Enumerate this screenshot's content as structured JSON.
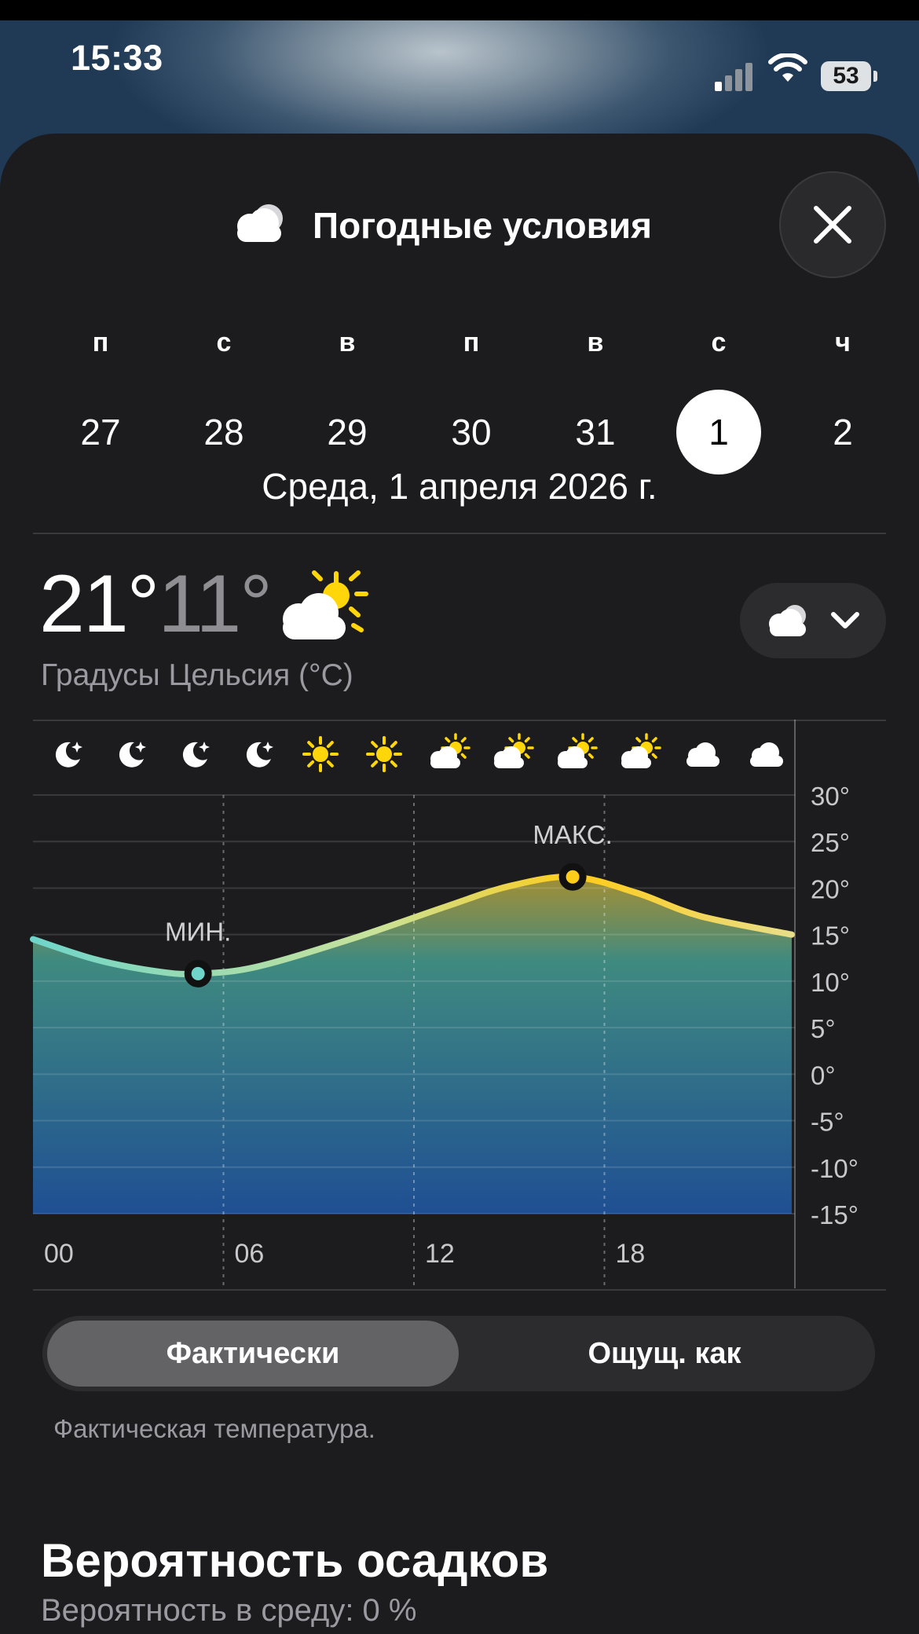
{
  "status_bar": {
    "time": "15:33",
    "battery": "53"
  },
  "sheet": {
    "title": "Погодные условия",
    "title_icon": "cloud-icon",
    "close_icon": "close-icon"
  },
  "days": [
    {
      "letter": "п",
      "number": "27",
      "selected": false
    },
    {
      "letter": "с",
      "number": "28",
      "selected": false
    },
    {
      "letter": "в",
      "number": "29",
      "selected": false
    },
    {
      "letter": "п",
      "number": "30",
      "selected": false
    },
    {
      "letter": "в",
      "number": "31",
      "selected": false
    },
    {
      "letter": "с",
      "number": "1",
      "selected": true
    },
    {
      "letter": "ч",
      "number": "2",
      "selected": false
    }
  ],
  "date_label": "Среда, 1 апреля 2026 г.",
  "summary": {
    "high": "21°",
    "low": "11°",
    "icon": "partly-sunny-icon",
    "unit_label": "Градусы Цельсия (°C)",
    "condition_selector_icon": "cloud-icon"
  },
  "chart_data": {
    "type": "area",
    "hour_icons": [
      "moon-icon",
      "moon-icon",
      "moon-icon",
      "moon-icon",
      "sun-icon",
      "sun-icon",
      "partly-sunny-icon",
      "partly-sunny-icon",
      "partly-sunny-icon",
      "partly-sunny-icon",
      "cloud-icon",
      "cloud-icon"
    ],
    "x_tick_labels": [
      "00",
      "06",
      "12",
      "18"
    ],
    "y_tick_labels": [
      "30°",
      "25°",
      "20°",
      "15°",
      "10°",
      "5°",
      "0°",
      "-5°",
      "-10°",
      "-15°"
    ],
    "ylim": [
      -15,
      30
    ],
    "x_hours": [
      0,
      2,
      4,
      5.2,
      7,
      10,
      13,
      15,
      17,
      19,
      21,
      23.9
    ],
    "temperatures": [
      14.5,
      12.3,
      11.0,
      10.8,
      11.5,
      14.5,
      18.0,
      20.2,
      21.2,
      19.5,
      17.0,
      15.0
    ],
    "min": {
      "label": "МИН.",
      "hour": 5.2,
      "value": 10.8
    },
    "max": {
      "label": "МАКС.",
      "hour": 17,
      "value": 21.2
    },
    "colors": {
      "cold": "#6fd5c9",
      "warm": "#ffcc1a",
      "fill_bottom": "#1f4f93"
    }
  },
  "toggle": {
    "actual": "Фактически",
    "feels_like": "Ощущ. как"
  },
  "caption": "Фактическая температура.",
  "precip": {
    "title": "Вероятность осадков",
    "subtitle": "Вероятность в среду: 0 %"
  }
}
